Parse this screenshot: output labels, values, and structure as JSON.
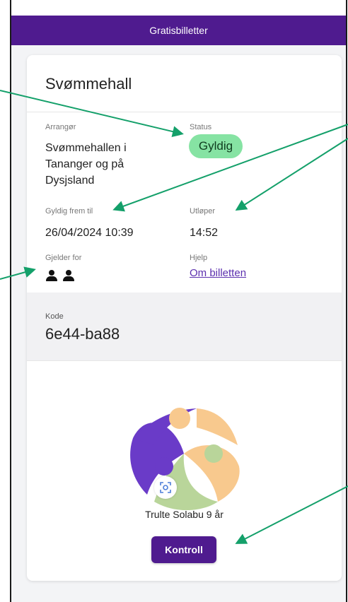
{
  "header": {
    "title": "Gratisbilletter"
  },
  "ticket": {
    "title": "Svømmehall",
    "organizer_label": "Arrangør",
    "organizer_value": "Svømmehallen i Tananger og på Dysjsland",
    "status_label": "Status",
    "status_value": "Gyldig",
    "valid_from_label": "Gyldig frem til",
    "valid_from_value": "26/04/2024 10:39",
    "expires_label": "Utløper",
    "expires_value": "14:52",
    "applies_label": "Gjelder for",
    "applies_icons": [
      "person-icon",
      "person-icon"
    ],
    "help_label": "Hjelp",
    "help_link": "Om billetten",
    "code_label": "Kode",
    "code_value": "6e44-ba88",
    "owner": "Trulte Solabu 9 år",
    "control_button": "Kontroll"
  },
  "colors": {
    "brand": "#4f1b8f",
    "status_green": "#86e3a3",
    "annotation_arrow": "#14a06a",
    "logo_purple": "#6a3bc8",
    "logo_orange": "#f8c98e",
    "logo_green": "#b9d59a"
  }
}
